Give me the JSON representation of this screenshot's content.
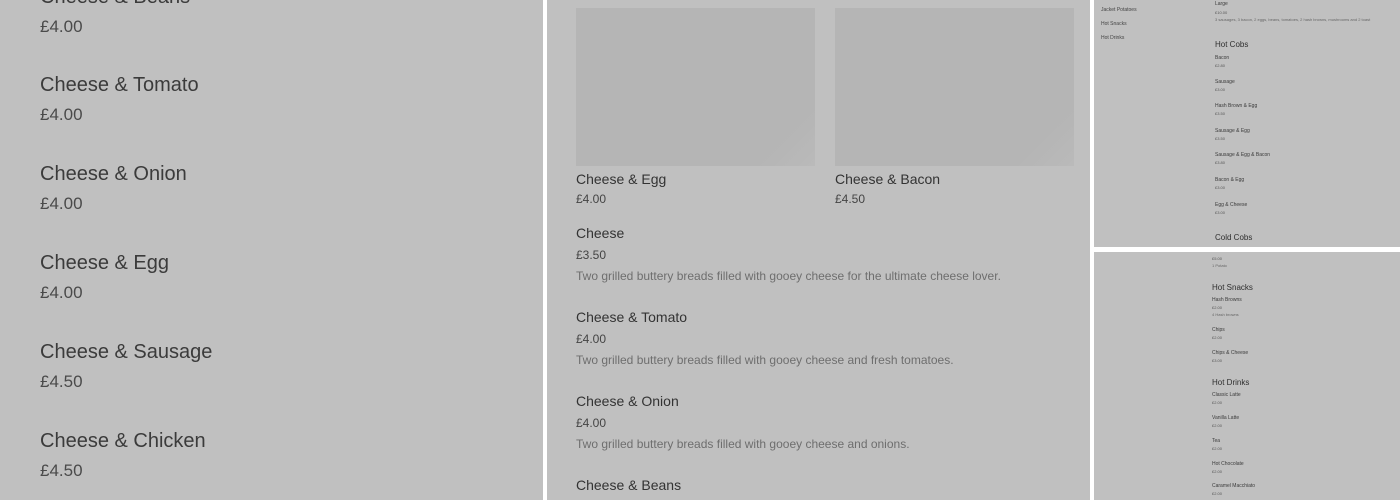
{
  "left_panel": {
    "items": [
      {
        "name": "Cheese & Beans",
        "price": "£4.00"
      },
      {
        "name": "Cheese & Tomato",
        "price": "£4.00"
      },
      {
        "name": "Cheese & Onion",
        "price": "£4.00"
      },
      {
        "name": "Cheese & Egg",
        "price": "£4.00"
      },
      {
        "name": "Cheese & Sausage",
        "price": "£4.50"
      },
      {
        "name": "Cheese & Chicken",
        "price": "£4.50"
      }
    ]
  },
  "mid_panel": {
    "cards": [
      {
        "name": "Cheese & Egg",
        "price": "£4.00"
      },
      {
        "name": "Cheese & Bacon",
        "price": "£4.50"
      }
    ],
    "items": [
      {
        "name": "Cheese",
        "price": "£3.50",
        "desc": "Two grilled buttery breads filled with gooey cheese for the ultimate cheese lover."
      },
      {
        "name": "Cheese & Tomato",
        "price": "£4.00",
        "desc": "Two grilled buttery breads filled with gooey cheese and fresh tomatoes."
      },
      {
        "name": "Cheese & Onion",
        "price": "£4.00",
        "desc": "Two grilled buttery breads filled with gooey cheese and onions."
      },
      {
        "name": "Cheese & Beans",
        "price": "",
        "desc": ""
      }
    ]
  },
  "right_top": {
    "nav": [
      "Jacket Potatoes",
      "Hot Snacks",
      "Hot Drinks"
    ],
    "large": {
      "name": "Large",
      "price": "£10.00",
      "desc": "3 sausages, 3 bacon, 2 eggs, beans, tomatoes, 2 hash browns, mushrooms and 2 toast"
    },
    "hot_cobs_heading": "Hot Cobs",
    "hot_cobs": [
      {
        "name": "Bacon",
        "price": "£2.80"
      },
      {
        "name": "Sausage",
        "price": "£3.00"
      },
      {
        "name": "Hash Brown & Egg",
        "price": "£3.50"
      },
      {
        "name": "Sausage & Egg",
        "price": "£3.50"
      },
      {
        "name": "Sausage & Egg & Bacon",
        "price": "£3.80"
      },
      {
        "name": "Bacon & Egg",
        "price": "£3.00"
      },
      {
        "name": "Egg & Cheese",
        "price": "£3.00"
      }
    ],
    "cold_cobs_heading": "Cold Cobs"
  },
  "right_bottom": {
    "top_price": "£5.00",
    "top_desc": "1 Potato",
    "hot_snacks_heading": "Hot Snacks",
    "hot_snacks": [
      {
        "name": "Hash Browns",
        "price": "£2.00",
        "desc": "4 Hash browns"
      },
      {
        "name": "Chips",
        "price": "£2.00",
        "desc": ""
      },
      {
        "name": "Chips & Cheese",
        "price": "£3.00",
        "desc": ""
      }
    ],
    "hot_drinks_heading": "Hot Drinks",
    "hot_drinks": [
      {
        "name": "Classic Latte",
        "price": "£2.00"
      },
      {
        "name": "Vanilla Latte",
        "price": "£2.00"
      },
      {
        "name": "Tea",
        "price": "£2.00"
      },
      {
        "name": "Hot Chocolate",
        "price": "£2.00"
      },
      {
        "name": "Caramel Macchiato",
        "price": "£2.00"
      }
    ]
  }
}
